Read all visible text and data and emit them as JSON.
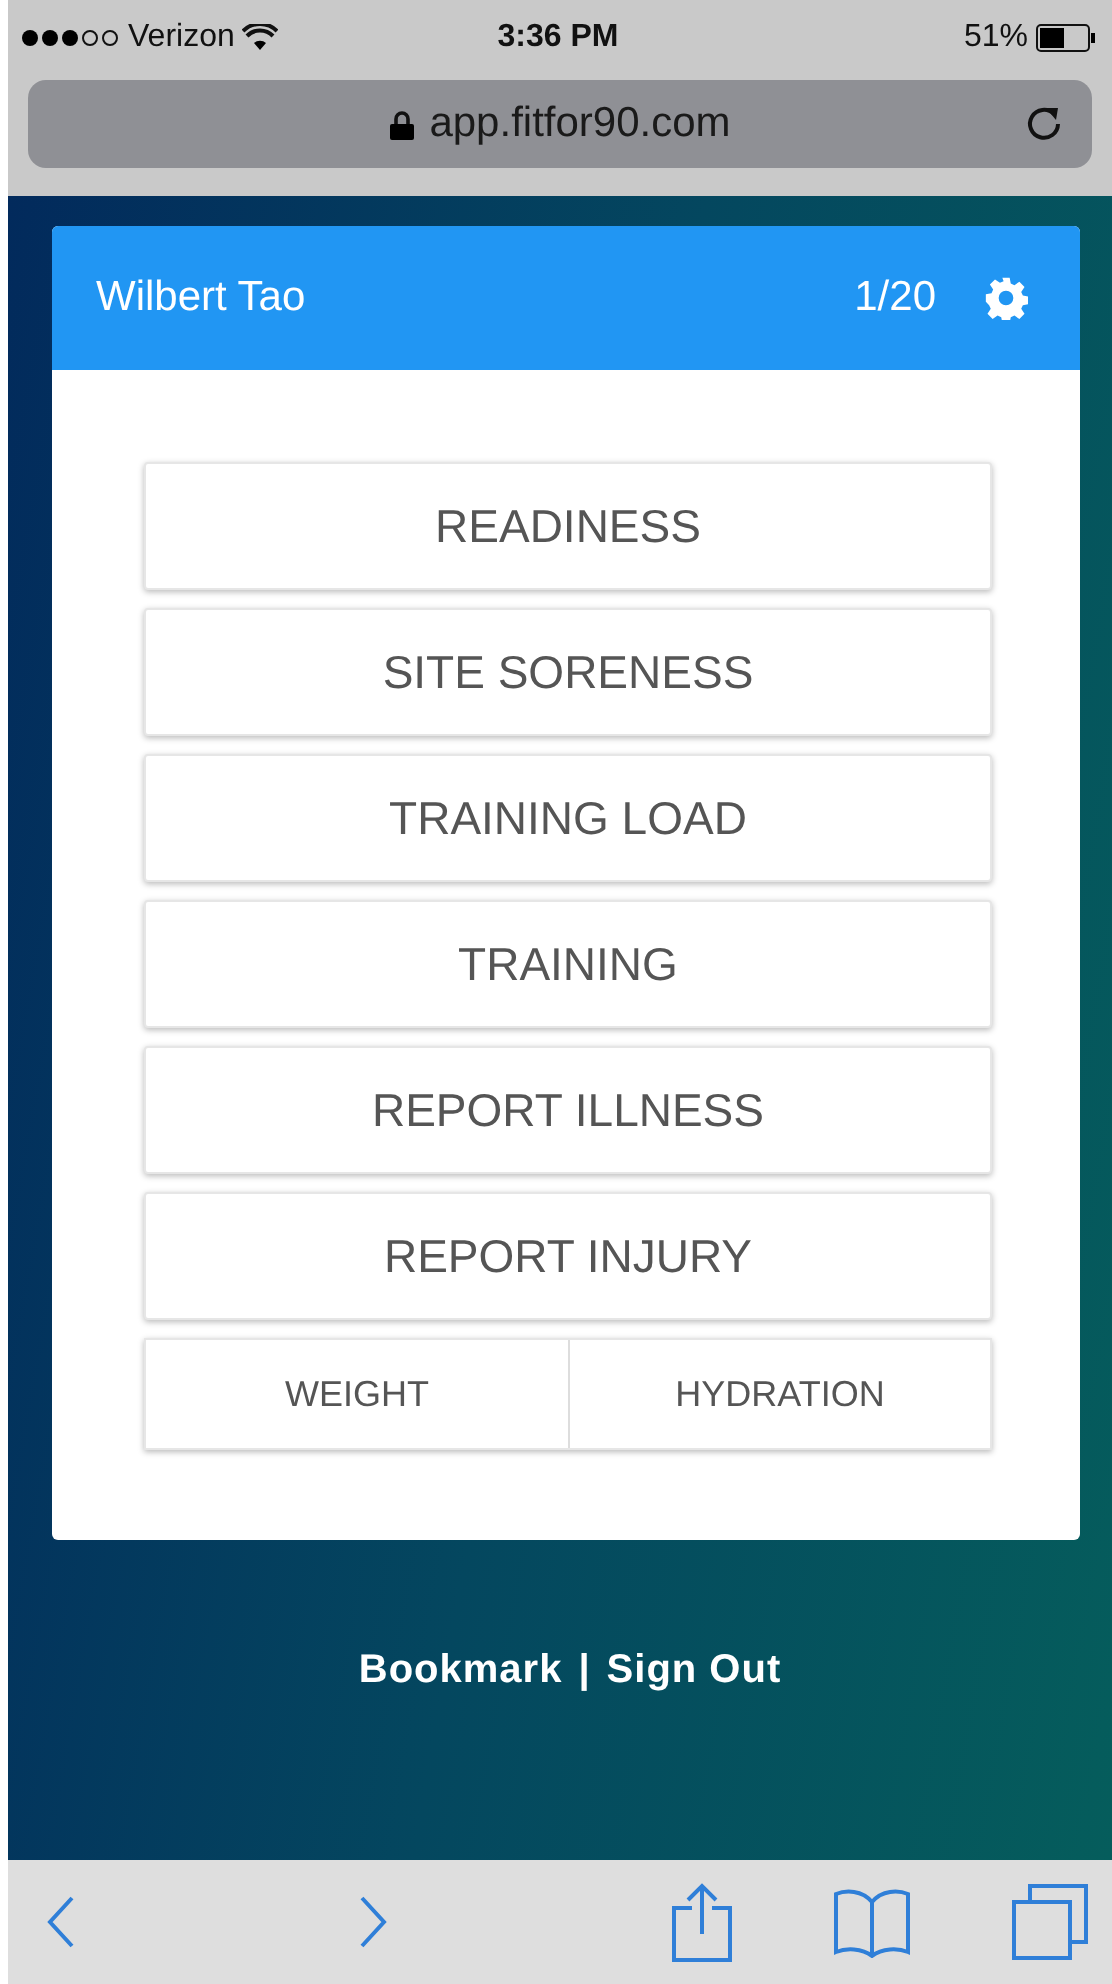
{
  "status_bar": {
    "carrier": "Verizon",
    "time": "3:36 PM",
    "battery": "51%"
  },
  "address_bar": {
    "url": "app.fitfor90.com"
  },
  "header": {
    "name": "Wilbert Tao",
    "counter": "1/20"
  },
  "menu": [
    {
      "kind": "full",
      "labels": [
        "READINESS"
      ]
    },
    {
      "kind": "full",
      "labels": [
        "SITE SORENESS"
      ]
    },
    {
      "kind": "full",
      "labels": [
        "TRAINING LOAD"
      ]
    },
    {
      "kind": "full",
      "labels": [
        "TRAINING"
      ]
    },
    {
      "kind": "full",
      "labels": [
        "REPORT ILLNESS"
      ]
    },
    {
      "kind": "full",
      "labels": [
        "REPORT INJURY"
      ]
    },
    {
      "kind": "split",
      "labels": [
        "WEIGHT",
        "HYDRATION"
      ]
    }
  ],
  "footer": {
    "links": [
      "Bookmark",
      "Sign Out"
    ],
    "separator": "|"
  }
}
